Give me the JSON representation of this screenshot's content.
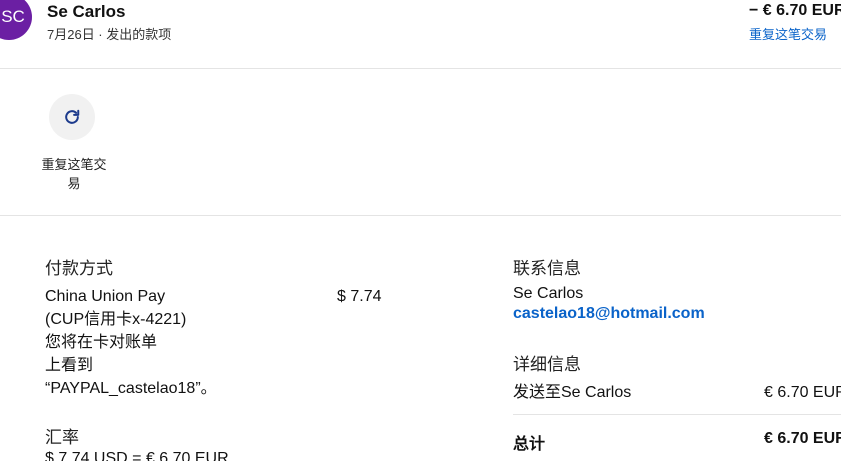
{
  "header": {
    "avatar_initials": "SC",
    "merchant_name": "Se Carlos",
    "meta": "7月26日 · 发出的款项",
    "amount": "− € 6.70 EUR",
    "repeat_link": "重复这笔交易"
  },
  "actions": {
    "repeat_label": "重复这笔交易",
    "repeat_icon": "refresh-icon"
  },
  "payment": {
    "title": "付款方式",
    "method_line1": "China Union Pay",
    "method_line2": "(CUP信用卡x-4221)",
    "method_line3": "您将在卡对账单",
    "method_line4": "上看到",
    "method_line5": "“PAYPAL_castelao18”。",
    "amount": "$ 7.74"
  },
  "exchange": {
    "title": "汇率",
    "line": "$ 7.74 USD = € 6.70 EUR"
  },
  "contact": {
    "title": "联系信息",
    "name": "Se Carlos",
    "email": "castelao18@hotmail.com"
  },
  "details": {
    "title": "详细信息",
    "sent_to_label": "发送至Se Carlos",
    "sent_to_value": "€ 6.70 EUR",
    "total_label": "总计",
    "total_value": "€ 6.70 EUR"
  },
  "colors": {
    "avatar": "#6b1fa3",
    "link": "#0a63c9",
    "icon": "#1c3a8c"
  }
}
